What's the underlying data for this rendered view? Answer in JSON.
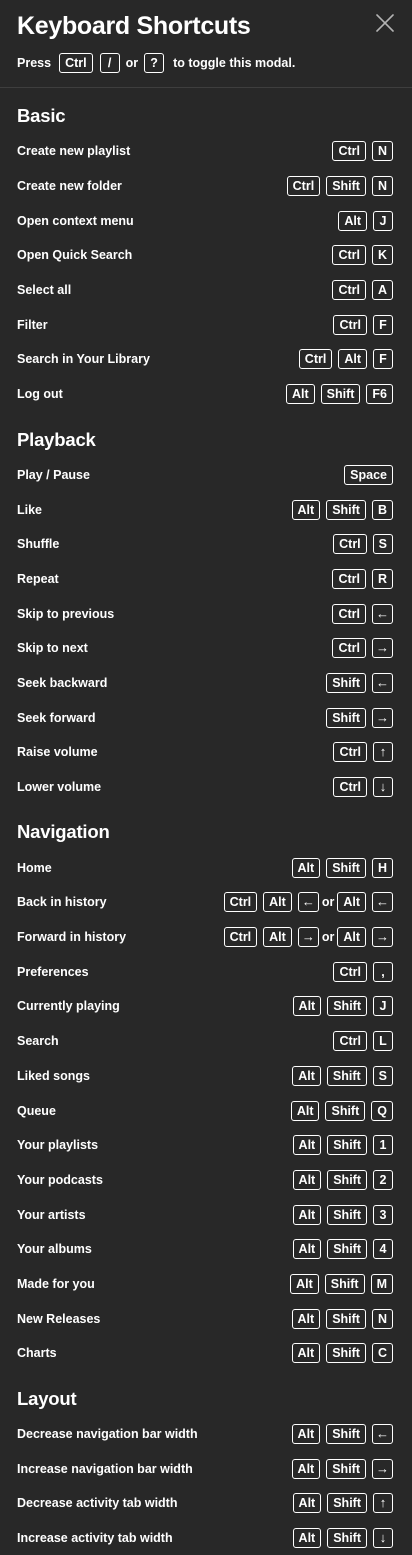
{
  "title": "Keyboard Shortcuts",
  "hint": {
    "press": "Press",
    "key1": "Ctrl",
    "key2": "/",
    "or": "or",
    "key3": "?",
    "suffix": "to toggle this modal."
  },
  "icons": {
    "close": "close-icon"
  },
  "sections": [
    {
      "title": "Basic",
      "rows": [
        {
          "label": "Create new playlist",
          "keys": [
            "Ctrl",
            "N"
          ]
        },
        {
          "label": "Create new folder",
          "keys": [
            "Ctrl",
            "Shift",
            "N"
          ]
        },
        {
          "label": "Open context menu",
          "keys": [
            "Alt",
            "J"
          ]
        },
        {
          "label": "Open Quick Search",
          "keys": [
            "Ctrl",
            "K"
          ]
        },
        {
          "label": "Select all",
          "keys": [
            "Ctrl",
            "A"
          ]
        },
        {
          "label": "Filter",
          "keys": [
            "Ctrl",
            "F"
          ]
        },
        {
          "label": "Search in Your Library",
          "keys": [
            "Ctrl",
            "Alt",
            "F"
          ]
        },
        {
          "label": "Log out",
          "keys": [
            "Alt",
            "Shift",
            "F6"
          ]
        }
      ]
    },
    {
      "title": "Playback",
      "rows": [
        {
          "label": "Play / Pause",
          "keys": [
            "Space"
          ]
        },
        {
          "label": "Like",
          "keys": [
            "Alt",
            "Shift",
            "B"
          ]
        },
        {
          "label": "Shuffle",
          "keys": [
            "Ctrl",
            "S"
          ]
        },
        {
          "label": "Repeat",
          "keys": [
            "Ctrl",
            "R"
          ]
        },
        {
          "label": "Skip to previous",
          "keys": [
            "Ctrl",
            "←"
          ]
        },
        {
          "label": "Skip to next",
          "keys": [
            "Ctrl",
            "→"
          ]
        },
        {
          "label": "Seek backward",
          "keys": [
            "Shift",
            "←"
          ]
        },
        {
          "label": "Seek forward",
          "keys": [
            "Shift",
            "→"
          ]
        },
        {
          "label": "Raise volume",
          "keys": [
            "Ctrl",
            "↑"
          ]
        },
        {
          "label": "Lower volume",
          "keys": [
            "Ctrl",
            "↓"
          ]
        }
      ]
    },
    {
      "title": "Navigation",
      "rows": [
        {
          "label": "Home",
          "keys": [
            "Alt",
            "Shift",
            "H"
          ]
        },
        {
          "label": "Back in history",
          "keys": [
            "Ctrl",
            "Alt",
            "←",
            "or",
            "Alt",
            "←"
          ]
        },
        {
          "label": "Forward in history",
          "keys": [
            "Ctrl",
            "Alt",
            "→",
            "or",
            "Alt",
            "→"
          ]
        },
        {
          "label": "Preferences",
          "keys": [
            "Ctrl",
            ","
          ]
        },
        {
          "label": "Currently playing",
          "keys": [
            "Alt",
            "Shift",
            "J"
          ]
        },
        {
          "label": "Search",
          "keys": [
            "Ctrl",
            "L"
          ]
        },
        {
          "label": "Liked songs",
          "keys": [
            "Alt",
            "Shift",
            "S"
          ]
        },
        {
          "label": "Queue",
          "keys": [
            "Alt",
            "Shift",
            "Q"
          ]
        },
        {
          "label": "Your playlists",
          "keys": [
            "Alt",
            "Shift",
            "1"
          ]
        },
        {
          "label": "Your podcasts",
          "keys": [
            "Alt",
            "Shift",
            "2"
          ]
        },
        {
          "label": "Your artists",
          "keys": [
            "Alt",
            "Shift",
            "3"
          ]
        },
        {
          "label": "Your albums",
          "keys": [
            "Alt",
            "Shift",
            "4"
          ]
        },
        {
          "label": "Made for you",
          "keys": [
            "Alt",
            "Shift",
            "M"
          ]
        },
        {
          "label": "New Releases",
          "keys": [
            "Alt",
            "Shift",
            "N"
          ]
        },
        {
          "label": "Charts",
          "keys": [
            "Alt",
            "Shift",
            "C"
          ]
        }
      ]
    },
    {
      "title": "Layout",
      "rows": [
        {
          "label": "Decrease navigation bar width",
          "keys": [
            "Alt",
            "Shift",
            "←"
          ]
        },
        {
          "label": "Increase navigation bar width",
          "keys": [
            "Alt",
            "Shift",
            "→"
          ]
        },
        {
          "label": "Decrease activity tab width",
          "keys": [
            "Alt",
            "Shift",
            "↑"
          ]
        },
        {
          "label": "Increase activity tab width",
          "keys": [
            "Alt",
            "Shift",
            "↓"
          ]
        }
      ]
    }
  ]
}
